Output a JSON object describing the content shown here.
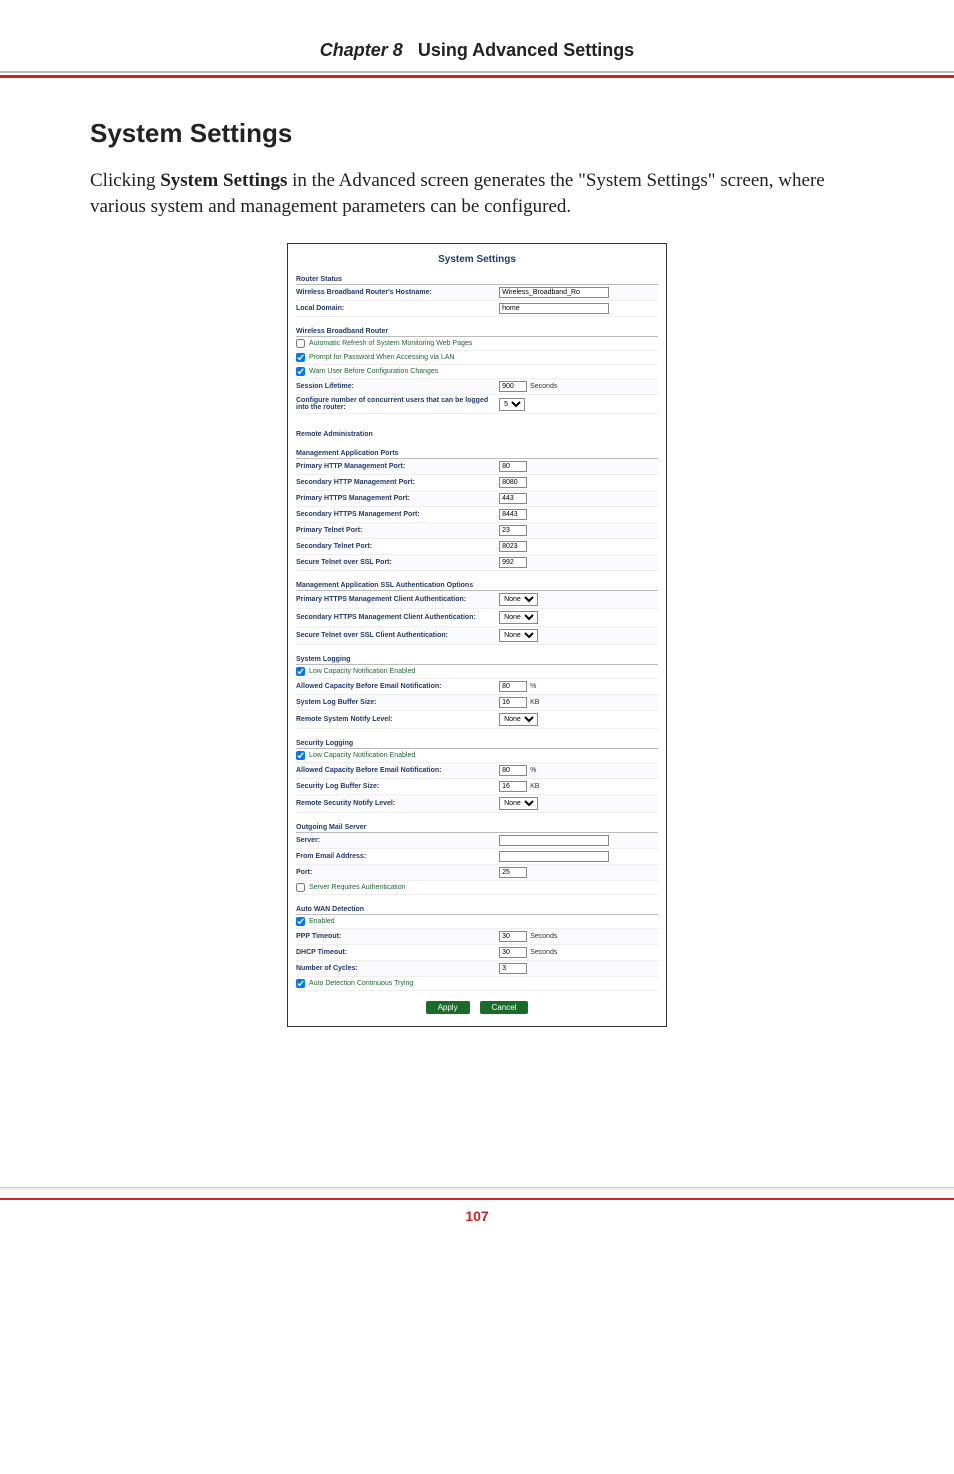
{
  "chapter": {
    "num": "Chapter 8",
    "name": "Using Advanced Settings"
  },
  "page_number": "107",
  "section_heading": "System Settings",
  "body_text_prefix": "Clicking ",
  "body_text_bold": "System Settings",
  "body_text_suffix": " in the Advanced screen generates the \"System Settings\" screen, where various system and management parameters can be configured.",
  "panel": {
    "title": "System Settings",
    "router_status": {
      "header": "Router Status",
      "hostname_label": "Wireless Broadband Router's Hostname:",
      "hostname_value": "Wireless_Broadband_Ro",
      "local_domain_label": "Local Domain:",
      "local_domain_value": "home"
    },
    "wbr": {
      "header": "Wireless Broadband Router",
      "auto_refresh_label": "Automatic Refresh of System Monitoring Web Pages",
      "auto_refresh_checked": false,
      "prompt_pw_label": "Prompt for Password When Accessing via LAN",
      "prompt_pw_checked": true,
      "warn_label": "Warn User Before Configuration Changes",
      "warn_checked": true,
      "session_lifetime_label": "Session Lifetime:",
      "session_lifetime_value": "900",
      "session_lifetime_unit": "Seconds",
      "concurrent_label": "Configure number of concurrent users that can be logged into the router:",
      "concurrent_value": "5"
    },
    "remote_admin_header": "Remote Administration",
    "mgmt_ports": {
      "header": "Management Application Ports",
      "primary_http_label": "Primary HTTP Management Port:",
      "primary_http_value": "80",
      "secondary_http_label": "Secondary HTTP Management Port:",
      "secondary_http_value": "8080",
      "primary_https_label": "Primary HTTPS Management Port:",
      "primary_https_value": "443",
      "secondary_https_label": "Secondary HTTPS Management Port:",
      "secondary_https_value": "8443",
      "primary_telnet_label": "Primary Telnet Port:",
      "primary_telnet_value": "23",
      "secondary_telnet_label": "Secondary Telnet Port:",
      "secondary_telnet_value": "8023",
      "secure_telnet_ssl_label": "Secure Telnet over SSL Port:",
      "secure_telnet_ssl_value": "992"
    },
    "ssl_auth": {
      "header": "Management Application SSL Authentication Options",
      "primary_https_client_label": "Primary HTTPS Management Client Authentication:",
      "primary_https_client_value": "None",
      "secondary_https_client_label": "Secondary HTTPS Management Client Authentication:",
      "secondary_https_client_value": "None",
      "secure_telnet_client_label": "Secure Telnet over SSL Client Authentication:",
      "secure_telnet_client_value": "None"
    },
    "sys_log": {
      "header": "System Logging",
      "low_cap_label": "Low Capacity Notification Enabled",
      "low_cap_checked": true,
      "allowed_cap_label": "Allowed Capacity Before Email Notification:",
      "allowed_cap_value": "80",
      "allowed_cap_unit": "%",
      "buffer_label": "System Log Buffer Size:",
      "buffer_value": "16",
      "buffer_unit": "KB",
      "remote_label": "Remote System Notify Level:",
      "remote_value": "None"
    },
    "sec_log": {
      "header": "Security Logging",
      "low_cap_label": "Low Capacity Notification Enabled",
      "low_cap_checked": true,
      "allowed_cap_label": "Allowed Capacity Before Email Notification:",
      "allowed_cap_value": "80",
      "allowed_cap_unit": "%",
      "buffer_label": "Security Log Buffer Size:",
      "buffer_value": "16",
      "buffer_unit": "KB",
      "remote_label": "Remote Security Notify Level:",
      "remote_value": "None"
    },
    "mail": {
      "header": "Outgoing Mail Server",
      "server_label": "Server:",
      "server_value": "",
      "from_label": "From Email Address:",
      "from_value": "",
      "port_label": "Port:",
      "port_value": "25",
      "auth_label": "Server Requires Authentication",
      "auth_checked": false
    },
    "wan": {
      "header": "Auto WAN Detection",
      "enabled_label": "Enabled",
      "enabled_checked": true,
      "ppp_label": "PPP Timeout:",
      "ppp_value": "30",
      "ppp_unit": "Seconds",
      "dhcp_label": "DHCP Timeout:",
      "dhcp_value": "30",
      "dhcp_unit": "Seconds",
      "cycles_label": "Number of Cycles:",
      "cycles_value": "3",
      "continuous_label": "Auto Detection Continuous Trying",
      "continuous_checked": true
    },
    "buttons": {
      "apply": "Apply",
      "cancel": "Cancel"
    }
  }
}
